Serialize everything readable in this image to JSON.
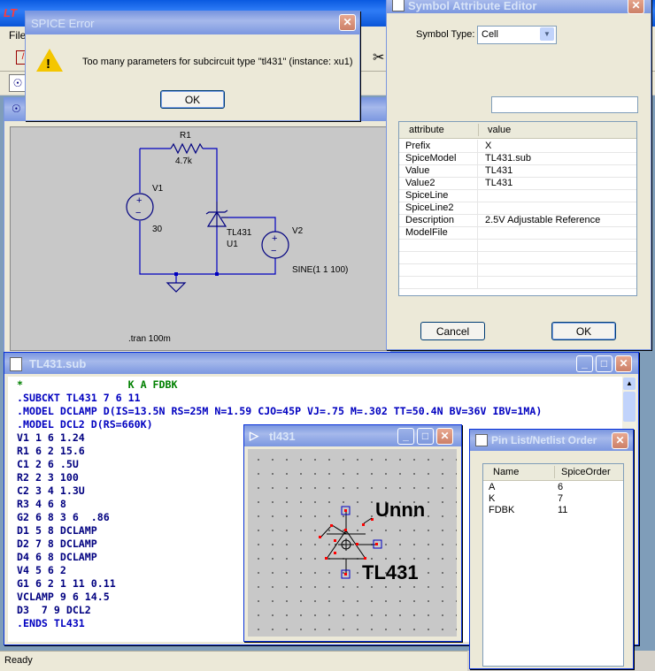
{
  "main_menu": {
    "file": "File"
  },
  "spice_error": {
    "title": "SPICE Error",
    "message": "Too many parameters for subcircuit type \"tl431\" (instance: xu1)",
    "ok_label": "OK"
  },
  "attr_editor": {
    "title": "Symbol Attribute Editor",
    "symbol_type_label": "Symbol Type:",
    "symbol_type_value": "Cell",
    "col_attribute": "attribute",
    "col_value": "value",
    "rows": [
      {
        "attribute": "Prefix",
        "value": "X"
      },
      {
        "attribute": "SpiceModel",
        "value": "TL431.sub"
      },
      {
        "attribute": "Value",
        "value": "TL431"
      },
      {
        "attribute": "Value2",
        "value": "TL431"
      },
      {
        "attribute": "SpiceLine",
        "value": ""
      },
      {
        "attribute": "SpiceLine2",
        "value": ""
      },
      {
        "attribute": "Description",
        "value": "2.5V Adjustable Reference"
      },
      {
        "attribute": "ModelFile",
        "value": ""
      }
    ],
    "cancel_label": "Cancel",
    "ok_label": "OK"
  },
  "schematic": {
    "r1_name": "R1",
    "r1_value": "4.7k",
    "v1_name": "V1",
    "v1_value": "30",
    "u1_type": "TL431",
    "u1_name": "U1",
    "v2_name": "V2",
    "v2_value": "SINE(1 1 100)",
    "directive": ".tran 100m"
  },
  "netlist_window": {
    "title": "TL431.sub",
    "lines": [
      {
        "text": "*                 K A FDBK",
        "color": "#008000"
      },
      {
        "text": ".SUBCKT TL431 7 6 11",
        "color": "#0000c0"
      },
      {
        "text": ".MODEL DCLAMP D(IS=13.5N RS=25M N=1.59 CJO=45P VJ=.75 M=.302 TT=50.4N BV=36V IBV=1MA)",
        "color": "#0000c0"
      },
      {
        "text": ".MODEL DCL2 D(RS=660K)",
        "color": "#0000c0"
      },
      {
        "text": "V1 1 6 1.24",
        "color": "#000080"
      },
      {
        "text": "R1 6 2 15.6",
        "color": "#000080"
      },
      {
        "text": "C1 2 6 .5U",
        "color": "#000080"
      },
      {
        "text": "R2 2 3 100",
        "color": "#000080"
      },
      {
        "text": "C2 3 4 1.3U",
        "color": "#000080"
      },
      {
        "text": "R3 4 6 8",
        "color": "#000080"
      },
      {
        "text": "G2 6 8 3 6  .86",
        "color": "#000080"
      },
      {
        "text": "D1 5 8 DCLAMP",
        "color": "#000080"
      },
      {
        "text": "D2 7 8 DCLAMP",
        "color": "#000080"
      },
      {
        "text": "D4 6 8 DCLAMP",
        "color": "#000080"
      },
      {
        "text": "V4 5 6 2",
        "color": "#000080"
      },
      {
        "text": "G1 6 2 1 11 0.11",
        "color": "#000080"
      },
      {
        "text": "VCLAMP 9 6 14.5",
        "color": "#000080"
      },
      {
        "text": "D3  7 9 DCL2",
        "color": "#000080"
      },
      {
        "text": ".ENDS TL431",
        "color": "#0000c0"
      }
    ]
  },
  "symbol_window": {
    "title": "tl431",
    "inst_label": "Unnn",
    "value_label": "TL431"
  },
  "pinlist_window": {
    "title": "Pin List/Netlist Order",
    "col_name": "Name",
    "col_order": "SpiceOrder",
    "pins": [
      {
        "name": "A",
        "order": "6"
      },
      {
        "name": "K",
        "order": "7"
      },
      {
        "name": "FDBK",
        "order": "11"
      }
    ]
  },
  "status_bar": {
    "text": "Ready"
  },
  "colors": {
    "xp_title": "#0a5ae0",
    "schematic_bg": "#c8c8c8",
    "wire": "#0000c0",
    "component": "#000080",
    "netlist_comment": "#008000",
    "netlist_directive": "#0000c0",
    "pin_marker": "#ff0000"
  }
}
